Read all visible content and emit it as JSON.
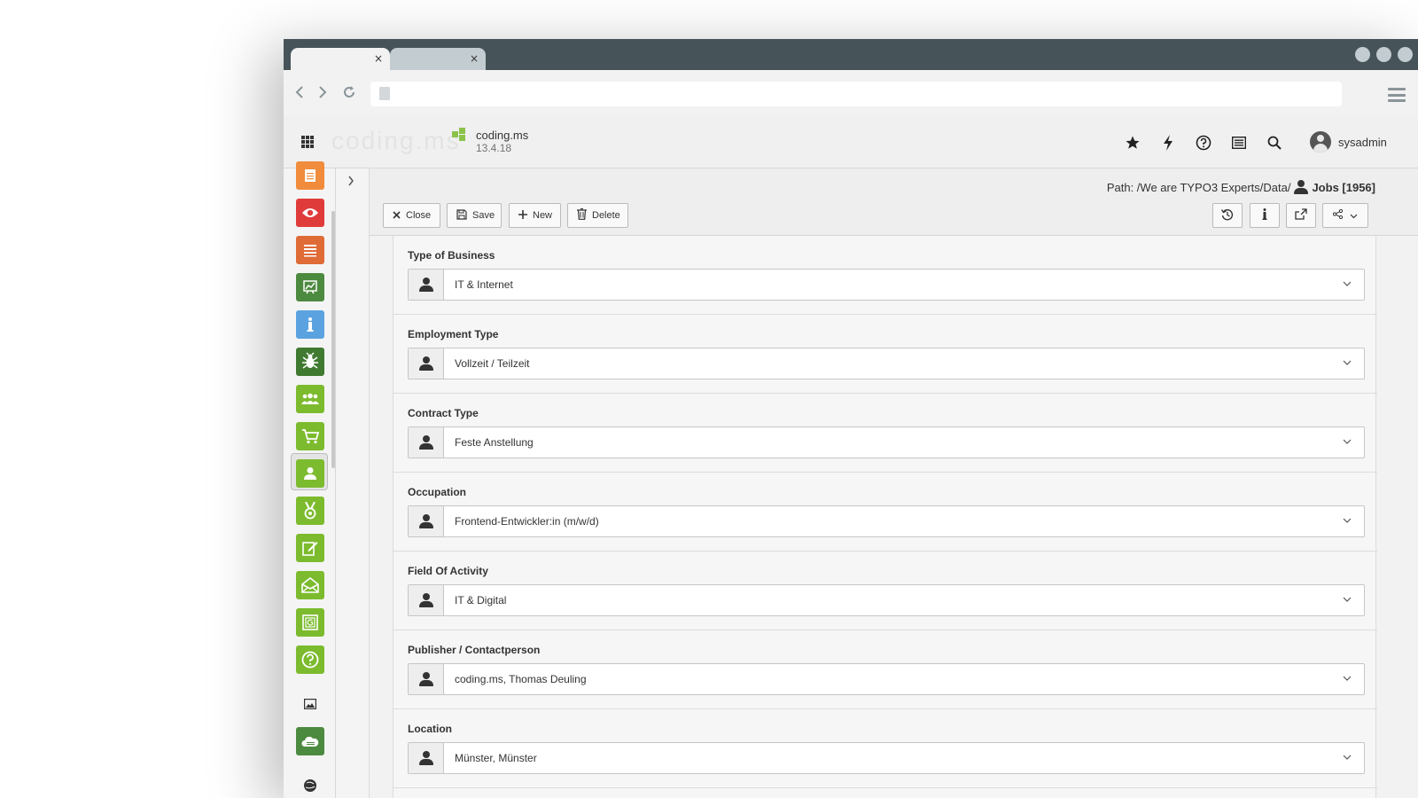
{
  "browser": {
    "tabs": [
      {
        "close_glyph": "×"
      },
      {
        "close_glyph": "×"
      }
    ]
  },
  "topbar": {
    "logo_text": "coding.ms",
    "site_name": "coding.ms",
    "site_version": "13.4.18",
    "user_name": "sysadmin",
    "icons": [
      "star-icon",
      "flash-icon",
      "help-icon",
      "list-icon",
      "search-icon"
    ]
  },
  "modules": [
    {
      "icon": "page-icon",
      "color": "#f08c3c"
    },
    {
      "icon": "view-icon",
      "color": "#e03b3b"
    },
    {
      "icon": "list-icon",
      "color": "#df6b36"
    },
    {
      "icon": "report-icon",
      "color": "#4c8a3f"
    },
    {
      "icon": "info-icon",
      "color": "#5aa3e0"
    },
    {
      "icon": "bug-icon",
      "color": "#3f7a30"
    },
    {
      "icon": "users-icon",
      "color": "#7cbb2e"
    },
    {
      "icon": "cart-icon",
      "color": "#7cbb2e"
    },
    {
      "icon": "jobs-icon",
      "color": "#7cbb2e"
    },
    {
      "icon": "medal-icon",
      "color": "#7cbb2e"
    },
    {
      "icon": "edit-icon",
      "color": "#7cbb2e"
    },
    {
      "icon": "mail-icon",
      "color": "#7cbb2e"
    },
    {
      "icon": "glossary-icon",
      "color": "#7cbb2e"
    },
    {
      "icon": "question-icon",
      "color": "#7cbb2e"
    },
    {
      "icon": "image-icon",
      "color": "#f4f4f4"
    },
    {
      "icon": "cloud-icon",
      "color": "#4c8a3f"
    }
  ],
  "docheader": {
    "path_label": "Path: /We are TYPO3 Experts/Data/",
    "record_label": "Jobs [1956]",
    "buttons": {
      "close": "Close",
      "save": "Save",
      "new": "New",
      "delete": "Delete"
    }
  },
  "form": {
    "fields": [
      {
        "label": "Type of Business",
        "value": "IT & Internet"
      },
      {
        "label": "Employment Type",
        "value": "Vollzeit / Teilzeit"
      },
      {
        "label": "Contract Type",
        "value": "Feste Anstellung"
      },
      {
        "label": "Occupation",
        "value": "Frontend-Entwickler:in (m/w/d)"
      },
      {
        "label": "Field Of Activity",
        "value": "IT & Digital"
      },
      {
        "label": "Publisher / Contactperson",
        "value": "coding.ms, Thomas Deuling"
      },
      {
        "label": "Location",
        "value": "Münster, Münster"
      }
    ]
  }
}
